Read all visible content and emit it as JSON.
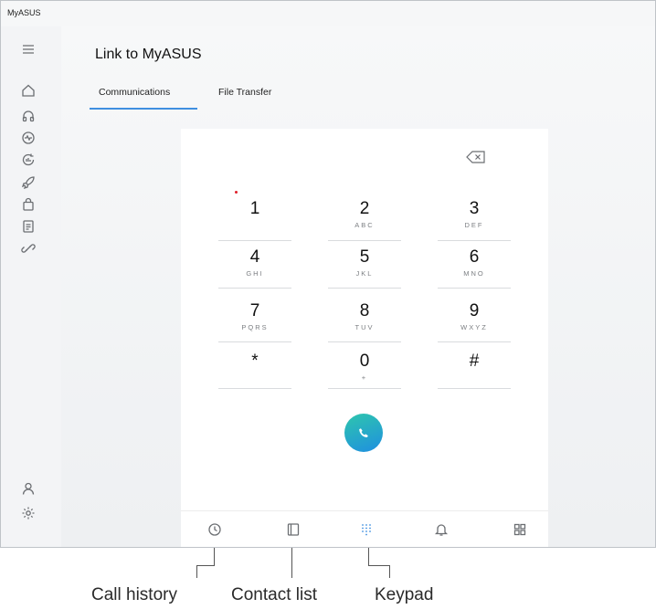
{
  "window": {
    "app_name": "MyASUS"
  },
  "sidebar": {
    "icons": [
      "hamburger-menu-icon",
      "home-icon",
      "headset-icon",
      "diagnostics-icon",
      "system-update-icon",
      "rocket-icon",
      "store-bag-icon",
      "document-icon",
      "link-icon",
      "account-icon",
      "settings-icon"
    ]
  },
  "header": {
    "title": "Link to MyASUS"
  },
  "tabs": [
    {
      "label": "Communications",
      "active": true
    },
    {
      "label": "File Transfer",
      "active": false
    }
  ],
  "accent_color": "#3f8fe0",
  "keypad": {
    "keys": [
      {
        "digit": "1",
        "letters": ""
      },
      {
        "digit": "2",
        "letters": "ABC"
      },
      {
        "digit": "3",
        "letters": "DEF"
      },
      {
        "digit": "4",
        "letters": "GHI"
      },
      {
        "digit": "5",
        "letters": "JKL"
      },
      {
        "digit": "6",
        "letters": "MNO"
      },
      {
        "digit": "7",
        "letters": "PQRS"
      },
      {
        "digit": "8",
        "letters": "TUV"
      },
      {
        "digit": "9",
        "letters": "WXYZ"
      },
      {
        "digit": "*",
        "letters": ""
      },
      {
        "digit": "0",
        "letters": "+"
      },
      {
        "digit": "#",
        "letters": ""
      }
    ]
  },
  "bottom_nav": [
    "call-history-icon",
    "contact-list-icon",
    "keypad-icon",
    "notifications-icon",
    "apps-icon"
  ],
  "callouts": {
    "call_history": "Call history",
    "contact_list": "Contact list",
    "keypad": "Keypad"
  }
}
